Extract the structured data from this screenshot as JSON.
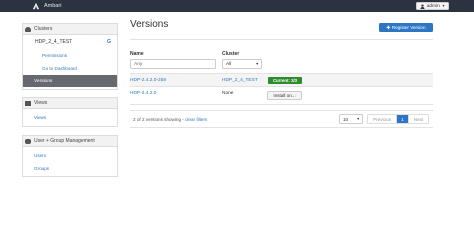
{
  "navbar": {
    "brand": "Ambari",
    "user_label": "admin"
  },
  "sidebar": {
    "clusters_header": "Clusters",
    "cluster_name": "HDP_2_4_TEST",
    "cluster_icon_letter": "G",
    "cluster_links": [
      "Permissions",
      "Go to Dashboard"
    ],
    "selected_item": "Versions",
    "views_header": "Views",
    "views_link": "Views",
    "users_header": "User + Group Management",
    "user_links": [
      "Users",
      "Groups"
    ]
  },
  "main": {
    "title": "Versions",
    "register_button": "Register Version",
    "filters": {
      "name_label": "Name",
      "name_placeholder": "Any",
      "cluster_label": "Cluster",
      "cluster_value": "All"
    },
    "rows": [
      {
        "name": "HDP-2.4.2.0-258",
        "cluster": "HDP_2_4_TEST",
        "status": "Current: 3/3"
      },
      {
        "name": "HDP-2.4.2.0",
        "cluster": "None",
        "action": "Install on..."
      }
    ],
    "footer": {
      "summary_prefix": "2 of 2 versions showing -",
      "clear_filters": "clear filters",
      "page_size": "10",
      "previous": "Previous",
      "current_page": "1",
      "next": "Next"
    }
  },
  "colors": {
    "navbar": "#2c3340",
    "primary": "#2e76c4",
    "success": "#2e8b2e",
    "selected": "#666a70"
  }
}
